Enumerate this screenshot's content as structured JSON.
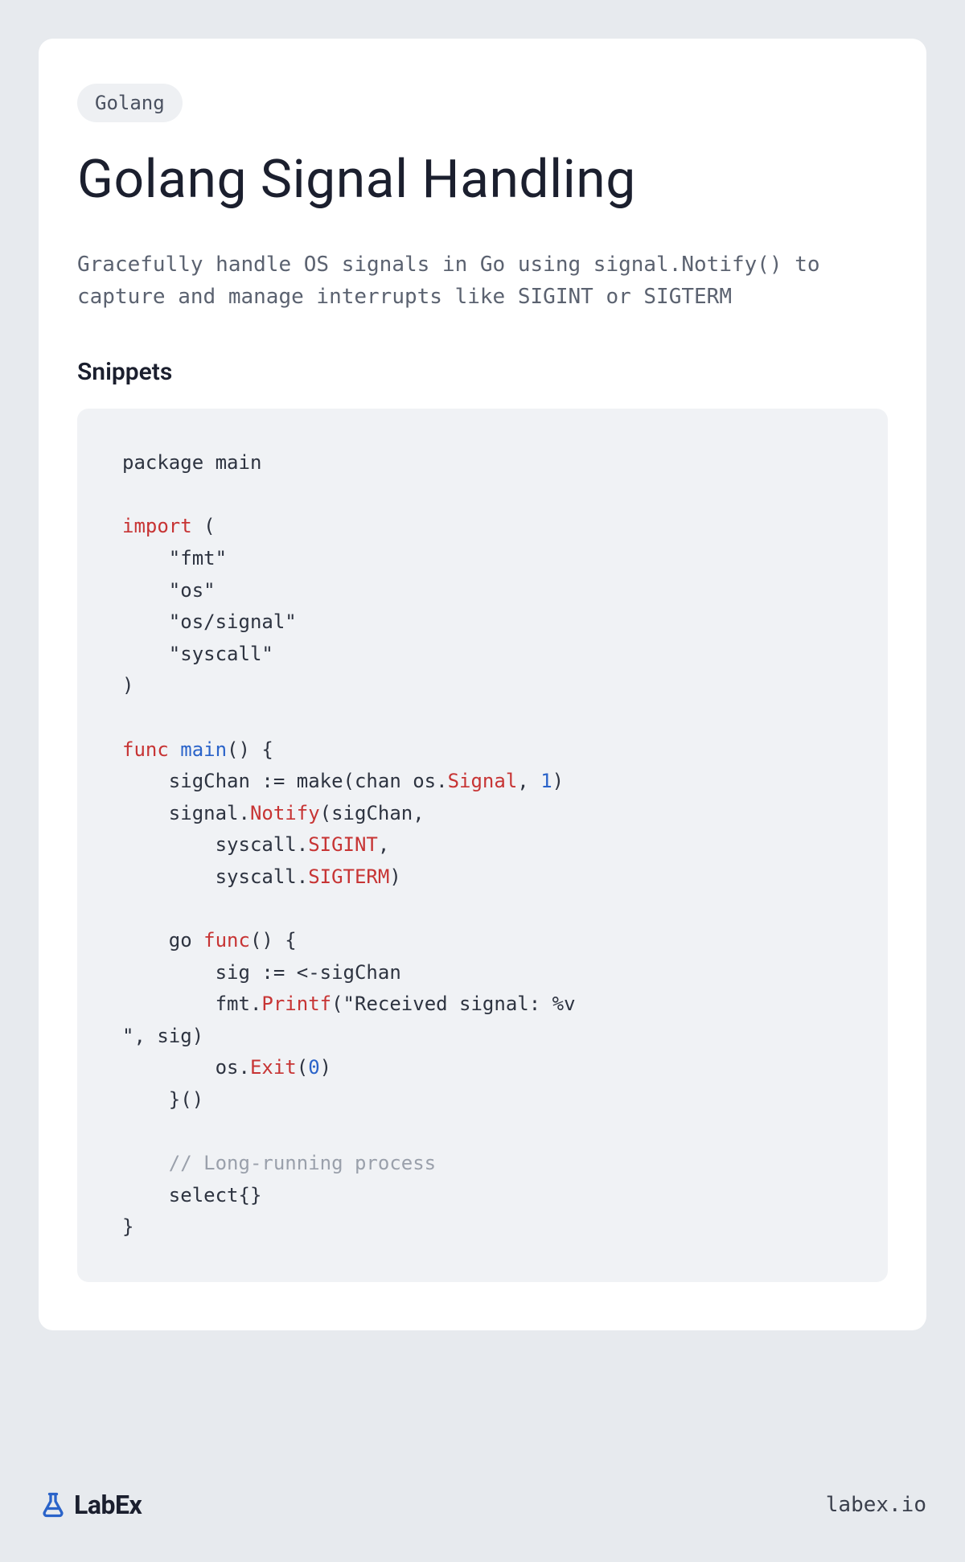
{
  "tag": "Golang",
  "title": "Golang Signal Handling",
  "description": "Gracefully handle OS signals in Go using signal.Notify() to capture and manage interrupts like SIGINT or SIGTERM",
  "section_heading": "Snippets",
  "code": {
    "line01": "package main",
    "kw_import": "import",
    "import_paren_open": " (",
    "import_fmt": "    \"fmt\"",
    "import_os": "    \"os\"",
    "import_signal": "    \"os/signal\"",
    "import_syscall": "    \"syscall\"",
    "import_paren_close": ")",
    "kw_func": "func",
    "fn_main": " main",
    "main_sig": "() {",
    "sigchan_decl": "    sigChan := make(chan os.",
    "sigchan_type": "Signal",
    "sigchan_rest1": ", ",
    "sigchan_num": "1",
    "sigchan_rest2": ")",
    "notify_pre": "    signal.",
    "notify_call": "Notify",
    "notify_args": "(sigChan,",
    "syscall_pre1": "        syscall.",
    "sigint": "SIGINT",
    "sigint_comma": ",",
    "syscall_pre2": "        syscall.",
    "sigterm": "SIGTERM",
    "sigterm_close": ")",
    "go_kw": "    go ",
    "go_func_kw": "func",
    "go_func_sig": "() {",
    "sig_recv": "        sig := <-sigChan",
    "printf_pre": "        fmt.",
    "printf_call": "Printf",
    "printf_args": "(\"Received signal: %v\n\", sig)",
    "exit_pre": "        os.",
    "exit_call": "Exit",
    "exit_args_open": "(",
    "exit_num": "0",
    "exit_args_close": ")",
    "go_close": "    }()",
    "comment": "    // Long-running process",
    "select": "    select{}",
    "main_close": "}"
  },
  "footer": {
    "brand": "LabEx",
    "url": "labex.io"
  }
}
